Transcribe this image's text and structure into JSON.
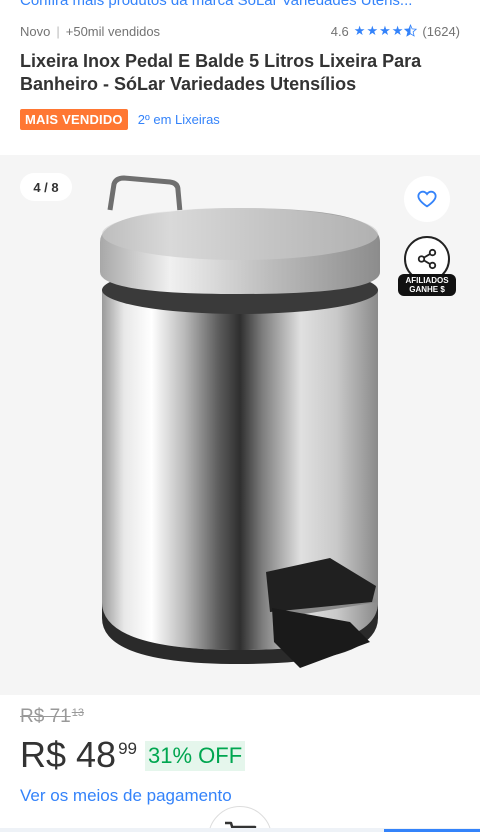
{
  "header": {
    "seller_link": "Confira mais produtos da marca SóLar Variedades Utens..."
  },
  "meta": {
    "condition": "Novo",
    "separator": "|",
    "sold": "+50mil vendidos",
    "rating": "4.6",
    "stars": 4.5,
    "reviews": "(1624)"
  },
  "product": {
    "title": "Lixeira Inox Pedal E Balde 5 Litros Lixeira Para Banheiro - SóLar Variedades Utensílios",
    "badge_best": "MAIS VENDIDO",
    "badge_rank": "2º em Lixeiras"
  },
  "gallery": {
    "counter": "4 / 8",
    "affiliate_line1": "AFILIADOS",
    "affiliate_line2": "GANHE $"
  },
  "price": {
    "old_main": "R$ 71",
    "old_cents": "13",
    "main": "R$ 48",
    "cents": "99",
    "discount": "31% OFF",
    "payment_link": "Ver os meios de pagamento"
  },
  "colors": {
    "accent": "#3483fa",
    "badge_orange": "#ff7733",
    "discount_green": "#00a650"
  },
  "icons": {
    "favorite": "heart-icon",
    "share": "share-icon",
    "cart": "cart-icon",
    "star": "star-icon"
  }
}
